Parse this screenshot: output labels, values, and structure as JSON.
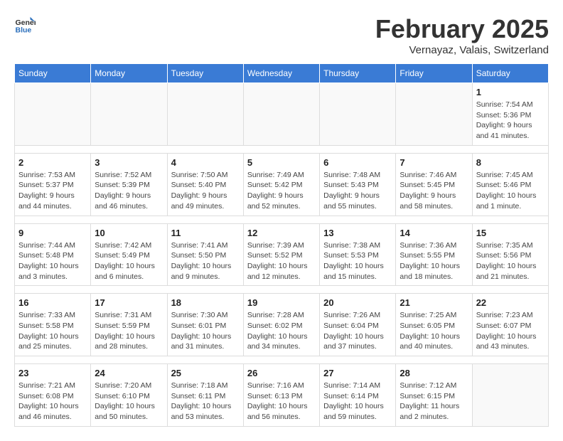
{
  "logo": {
    "general": "General",
    "blue": "Blue"
  },
  "title": "February 2025",
  "location": "Vernayaz, Valais, Switzerland",
  "days_of_week": [
    "Sunday",
    "Monday",
    "Tuesday",
    "Wednesday",
    "Thursday",
    "Friday",
    "Saturday"
  ],
  "weeks": [
    [
      {
        "day": "",
        "info": ""
      },
      {
        "day": "",
        "info": ""
      },
      {
        "day": "",
        "info": ""
      },
      {
        "day": "",
        "info": ""
      },
      {
        "day": "",
        "info": ""
      },
      {
        "day": "",
        "info": ""
      },
      {
        "day": "1",
        "info": "Sunrise: 7:54 AM\nSunset: 5:36 PM\nDaylight: 9 hours and 41 minutes."
      }
    ],
    [
      {
        "day": "2",
        "info": "Sunrise: 7:53 AM\nSunset: 5:37 PM\nDaylight: 9 hours and 44 minutes."
      },
      {
        "day": "3",
        "info": "Sunrise: 7:52 AM\nSunset: 5:39 PM\nDaylight: 9 hours and 46 minutes."
      },
      {
        "day": "4",
        "info": "Sunrise: 7:50 AM\nSunset: 5:40 PM\nDaylight: 9 hours and 49 minutes."
      },
      {
        "day": "5",
        "info": "Sunrise: 7:49 AM\nSunset: 5:42 PM\nDaylight: 9 hours and 52 minutes."
      },
      {
        "day": "6",
        "info": "Sunrise: 7:48 AM\nSunset: 5:43 PM\nDaylight: 9 hours and 55 minutes."
      },
      {
        "day": "7",
        "info": "Sunrise: 7:46 AM\nSunset: 5:45 PM\nDaylight: 9 hours and 58 minutes."
      },
      {
        "day": "8",
        "info": "Sunrise: 7:45 AM\nSunset: 5:46 PM\nDaylight: 10 hours and 1 minute."
      }
    ],
    [
      {
        "day": "9",
        "info": "Sunrise: 7:44 AM\nSunset: 5:48 PM\nDaylight: 10 hours and 3 minutes."
      },
      {
        "day": "10",
        "info": "Sunrise: 7:42 AM\nSunset: 5:49 PM\nDaylight: 10 hours and 6 minutes."
      },
      {
        "day": "11",
        "info": "Sunrise: 7:41 AM\nSunset: 5:50 PM\nDaylight: 10 hours and 9 minutes."
      },
      {
        "day": "12",
        "info": "Sunrise: 7:39 AM\nSunset: 5:52 PM\nDaylight: 10 hours and 12 minutes."
      },
      {
        "day": "13",
        "info": "Sunrise: 7:38 AM\nSunset: 5:53 PM\nDaylight: 10 hours and 15 minutes."
      },
      {
        "day": "14",
        "info": "Sunrise: 7:36 AM\nSunset: 5:55 PM\nDaylight: 10 hours and 18 minutes."
      },
      {
        "day": "15",
        "info": "Sunrise: 7:35 AM\nSunset: 5:56 PM\nDaylight: 10 hours and 21 minutes."
      }
    ],
    [
      {
        "day": "16",
        "info": "Sunrise: 7:33 AM\nSunset: 5:58 PM\nDaylight: 10 hours and 25 minutes."
      },
      {
        "day": "17",
        "info": "Sunrise: 7:31 AM\nSunset: 5:59 PM\nDaylight: 10 hours and 28 minutes."
      },
      {
        "day": "18",
        "info": "Sunrise: 7:30 AM\nSunset: 6:01 PM\nDaylight: 10 hours and 31 minutes."
      },
      {
        "day": "19",
        "info": "Sunrise: 7:28 AM\nSunset: 6:02 PM\nDaylight: 10 hours and 34 minutes."
      },
      {
        "day": "20",
        "info": "Sunrise: 7:26 AM\nSunset: 6:04 PM\nDaylight: 10 hours and 37 minutes."
      },
      {
        "day": "21",
        "info": "Sunrise: 7:25 AM\nSunset: 6:05 PM\nDaylight: 10 hours and 40 minutes."
      },
      {
        "day": "22",
        "info": "Sunrise: 7:23 AM\nSunset: 6:07 PM\nDaylight: 10 hours and 43 minutes."
      }
    ],
    [
      {
        "day": "23",
        "info": "Sunrise: 7:21 AM\nSunset: 6:08 PM\nDaylight: 10 hours and 46 minutes."
      },
      {
        "day": "24",
        "info": "Sunrise: 7:20 AM\nSunset: 6:10 PM\nDaylight: 10 hours and 50 minutes."
      },
      {
        "day": "25",
        "info": "Sunrise: 7:18 AM\nSunset: 6:11 PM\nDaylight: 10 hours and 53 minutes."
      },
      {
        "day": "26",
        "info": "Sunrise: 7:16 AM\nSunset: 6:13 PM\nDaylight: 10 hours and 56 minutes."
      },
      {
        "day": "27",
        "info": "Sunrise: 7:14 AM\nSunset: 6:14 PM\nDaylight: 10 hours and 59 minutes."
      },
      {
        "day": "28",
        "info": "Sunrise: 7:12 AM\nSunset: 6:15 PM\nDaylight: 11 hours and 2 minutes."
      },
      {
        "day": "",
        "info": ""
      }
    ]
  ]
}
